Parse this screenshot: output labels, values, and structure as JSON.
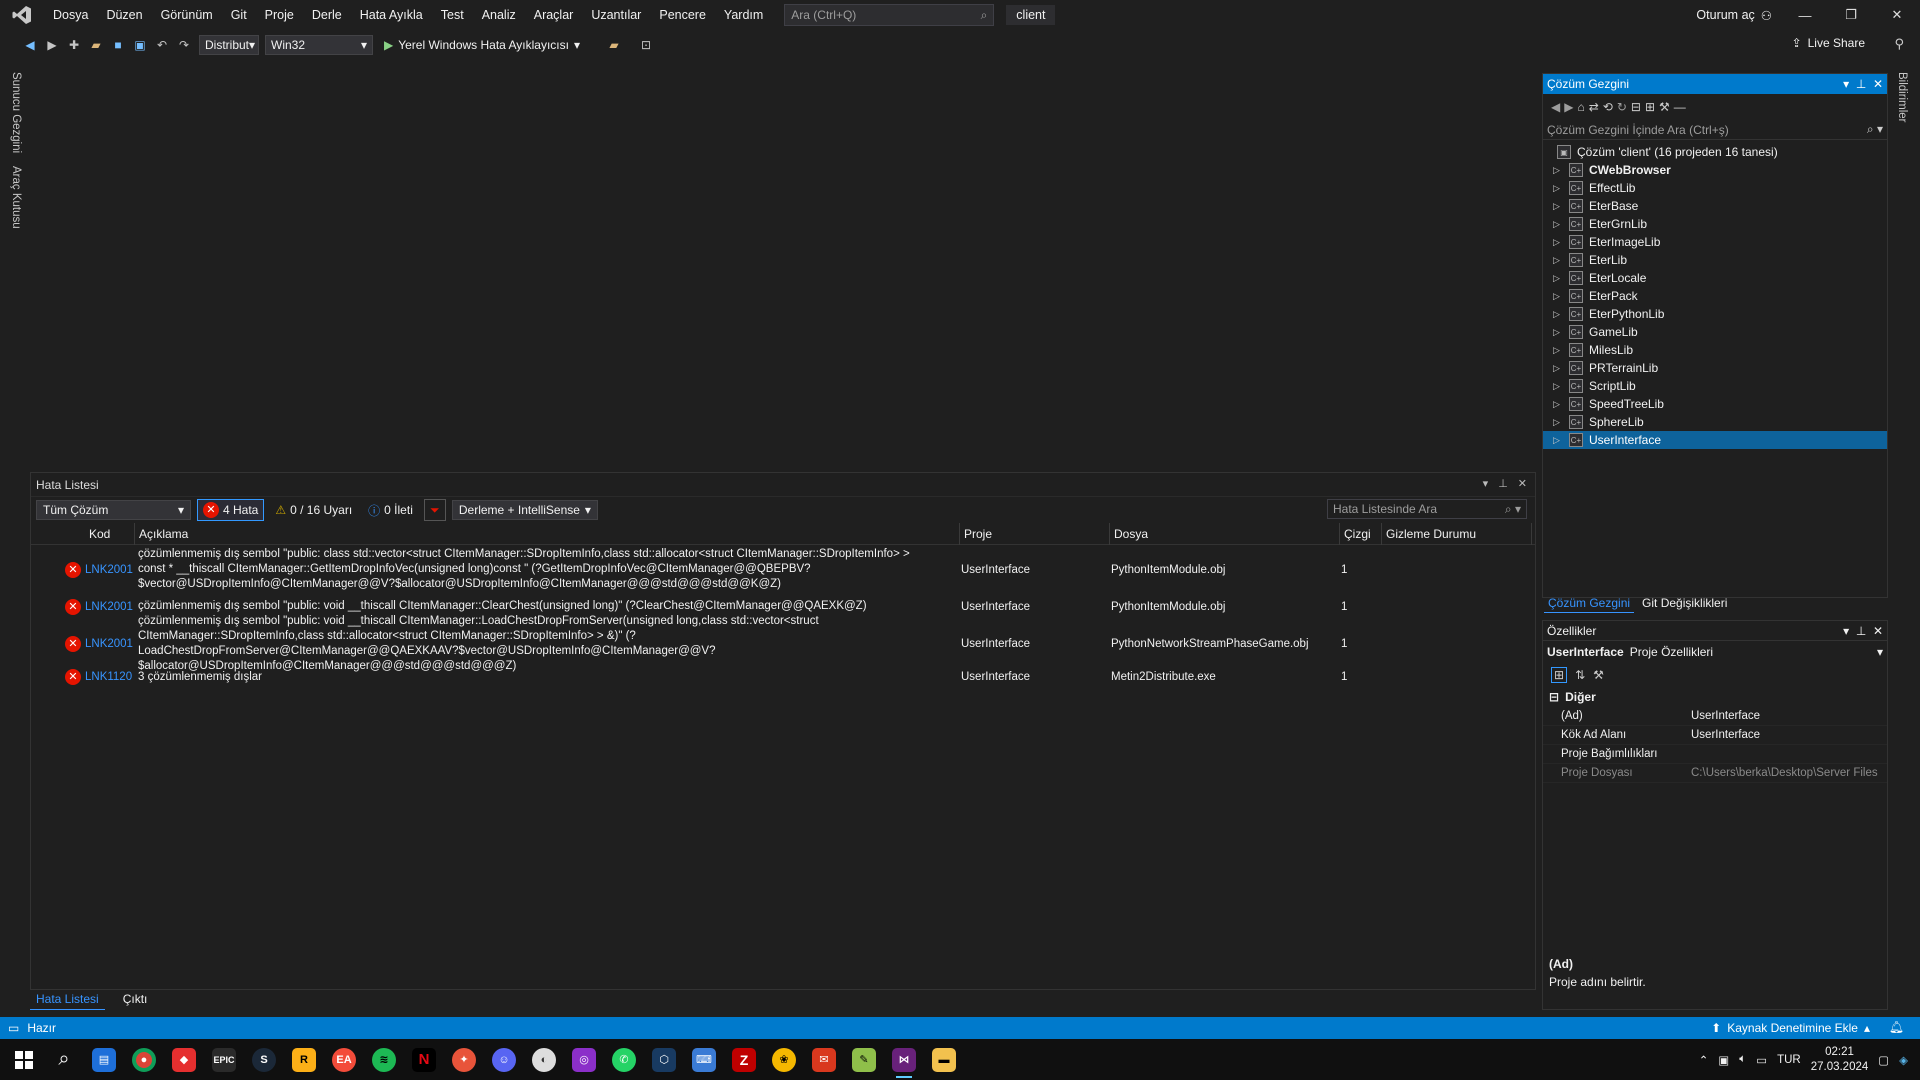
{
  "menu": {
    "items": [
      "Dosya",
      "Düzen",
      "Görünüm",
      "Git",
      "Proje",
      "Derle",
      "Hata Ayıkla",
      "Test",
      "Analiz",
      "Araçlar",
      "Uzantılar",
      "Pencere",
      "Yardım"
    ],
    "search_placeholder": "Ara (Ctrl+Q)",
    "solution_name": "client",
    "signin_label": "Oturum aç"
  },
  "toolbar": {
    "configuration": "Distribut",
    "platform": "Win32",
    "run_label": "Yerel Windows Hata Ayıklayıcısı",
    "live_share_label": "Live Share"
  },
  "side_tabs": {
    "left": [
      "Sunucu Gezgini",
      "Araç Kutusu"
    ],
    "right": [
      "Bildirimler"
    ]
  },
  "error_list": {
    "title": "Hata Listesi",
    "scope": "Tüm Çözüm",
    "errors_label": "4 Hata",
    "warnings_label": "0 / 16 Uyarı",
    "messages_label": "0 İleti",
    "build_filter": "Derleme + IntelliSense",
    "search_placeholder": "Hata Listesinde Ara",
    "columns": [
      "Kod",
      "Açıklama",
      "Proje",
      "Dosya",
      "Çizgi",
      "Gizleme Durumu"
    ],
    "rows": [
      {
        "code": "LNK2001",
        "description": "çözümlenmemiş dış sembol \"public: class std::vector<struct CItemManager::SDropItemInfo,class std::allocator<struct CItemManager::SDropItemInfo> >\nconst * __thiscall CItemManager::GetItemDropInfoVec(unsigned long)const \" (?GetItemDropInfoVec@CItemManager@@QBEPBV?\n$vector@USDropItemInfo@CItemManager@@V?$allocator@USDropItemInfo@CItemManager@@@std@@@std@@K@Z)",
        "project": "UserInterface",
        "file": "PythonItemModule.obj",
        "line": "1"
      },
      {
        "code": "LNK2001",
        "description": "çözümlenmemiş dış sembol \"public: void __thiscall CItemManager::ClearChest(unsigned long)\" (?ClearChest@CItemManager@@QAEXK@Z)",
        "project": "UserInterface",
        "file": "PythonItemModule.obj",
        "line": "1"
      },
      {
        "code": "LNK2001",
        "description": "çözümlenmemiş dış sembol \"public: void __thiscall CItemManager::LoadChestDropFromServer(unsigned long,class std::vector<struct\nCItemManager::SDropItemInfo,class std::allocator<struct CItemManager::SDropItemInfo> > &)\" (?\nLoadChestDropFromServer@CItemManager@@QAEXKAAV?$vector@USDropItemInfo@CItemManager@@V?\n$allocator@USDropItemInfo@CItemManager@@@std@@@std@@@Z)",
        "project": "UserInterface",
        "file": "PythonNetworkStreamPhaseGame.obj",
        "line": "1"
      },
      {
        "code": "LNK1120",
        "description": "3 çözümlenmemiş dışlar",
        "project": "UserInterface",
        "file": "Metin2Distribute.exe",
        "line": "1"
      }
    ]
  },
  "bottom_tabs": [
    "Hata Listesi",
    "Çıktı"
  ],
  "solution_explorer": {
    "title": "Çözüm Gezgini",
    "search_placeholder": "Çözüm Gezgini İçinde Ara (Ctrl+ş)",
    "root": "Çözüm 'client' (16 projeden 16 tanesi)",
    "projects": [
      "CWebBrowser",
      "EffectLib",
      "EterBase",
      "EterGrnLib",
      "EterImageLib",
      "EterLib",
      "EterLocale",
      "EterPack",
      "EterPythonLib",
      "GameLib",
      "MilesLib",
      "PRTerrainLib",
      "ScriptLib",
      "SpeedTreeLib",
      "SphereLib",
      "UserInterface"
    ],
    "tabs": [
      "Çözüm Gezgini",
      "Git Değişiklikleri"
    ]
  },
  "properties": {
    "title": "Özellikler",
    "object_name": "UserInterface",
    "object_type": "Proje Özellikleri",
    "category": "Diğer",
    "rows": [
      {
        "name": "(Ad)",
        "value": "UserInterface"
      },
      {
        "name": "Kök Ad Alanı",
        "value": "UserInterface"
      },
      {
        "name": "Proje Bağımlılıkları",
        "value": ""
      },
      {
        "name": "Proje Dosyası",
        "value": "C:\\Users\\berka\\Desktop\\Server Files"
      }
    ],
    "desc_title": "(Ad)",
    "desc_text": "Proje adını belirtir."
  },
  "statusbar": {
    "status": "Hazır",
    "source_control": "Kaynak Denetimine Ekle"
  },
  "taskbar": {
    "language": "TUR",
    "time": "02:21",
    "date": "27.03.2024"
  }
}
